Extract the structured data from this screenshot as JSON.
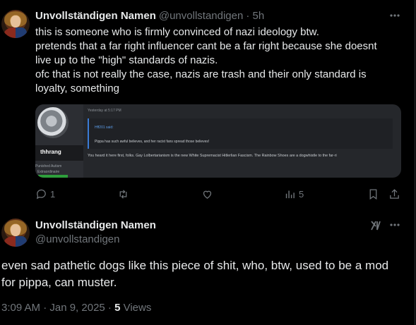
{
  "reply": {
    "name": "Unvollständigen Namen",
    "handle": "@unvollstandigen",
    "time": "· 5h",
    "lines": [
      "this is someone who is firmly convinced of nazi ideology btw.",
      "pretends that a far right influencer cant be a far right because she doesnt",
      "live up to the \"high\" standards of nazis.",
      "ofc that is not really the case, nazis are trash and their only standard is",
      "loyalty, something"
    ],
    "embed": {
      "username": "thhrang",
      "user_title": [
        "Punished Autism",
        "Extraordinaire"
      ],
      "timestamp": "Yesterday at 5:17 PM",
      "quote_author": "Hff201 said:",
      "quote_text": "Pippa has such awful believes, and her racist fans spread those believes!",
      "body_text": "You heard it here first, folks. Gay Lolbertarianism is the new White Supremacist Hitlerlian Fascism. The Rainbow Shoes are a dogwhistle to the far-ri"
    },
    "actions": {
      "replies": "1",
      "retweets": "",
      "likes": "",
      "views": "5"
    }
  },
  "main": {
    "name": "Unvollständigen Namen",
    "handle": "@unvollstandigen",
    "lines": [
      "even sad pathetic dogs like this piece of shit, who, btw, used to be a mod",
      "for pippa, can muster."
    ],
    "timestamp": "3:09 AM · Jan 9, 2025 · ",
    "views_count": "5",
    "views_label": " Views"
  },
  "icons": [
    "avatar",
    "more-icon",
    "reply-icon",
    "retweet-icon",
    "like-icon",
    "views-icon",
    "bookmark-icon",
    "share-icon",
    "grok-icon"
  ]
}
